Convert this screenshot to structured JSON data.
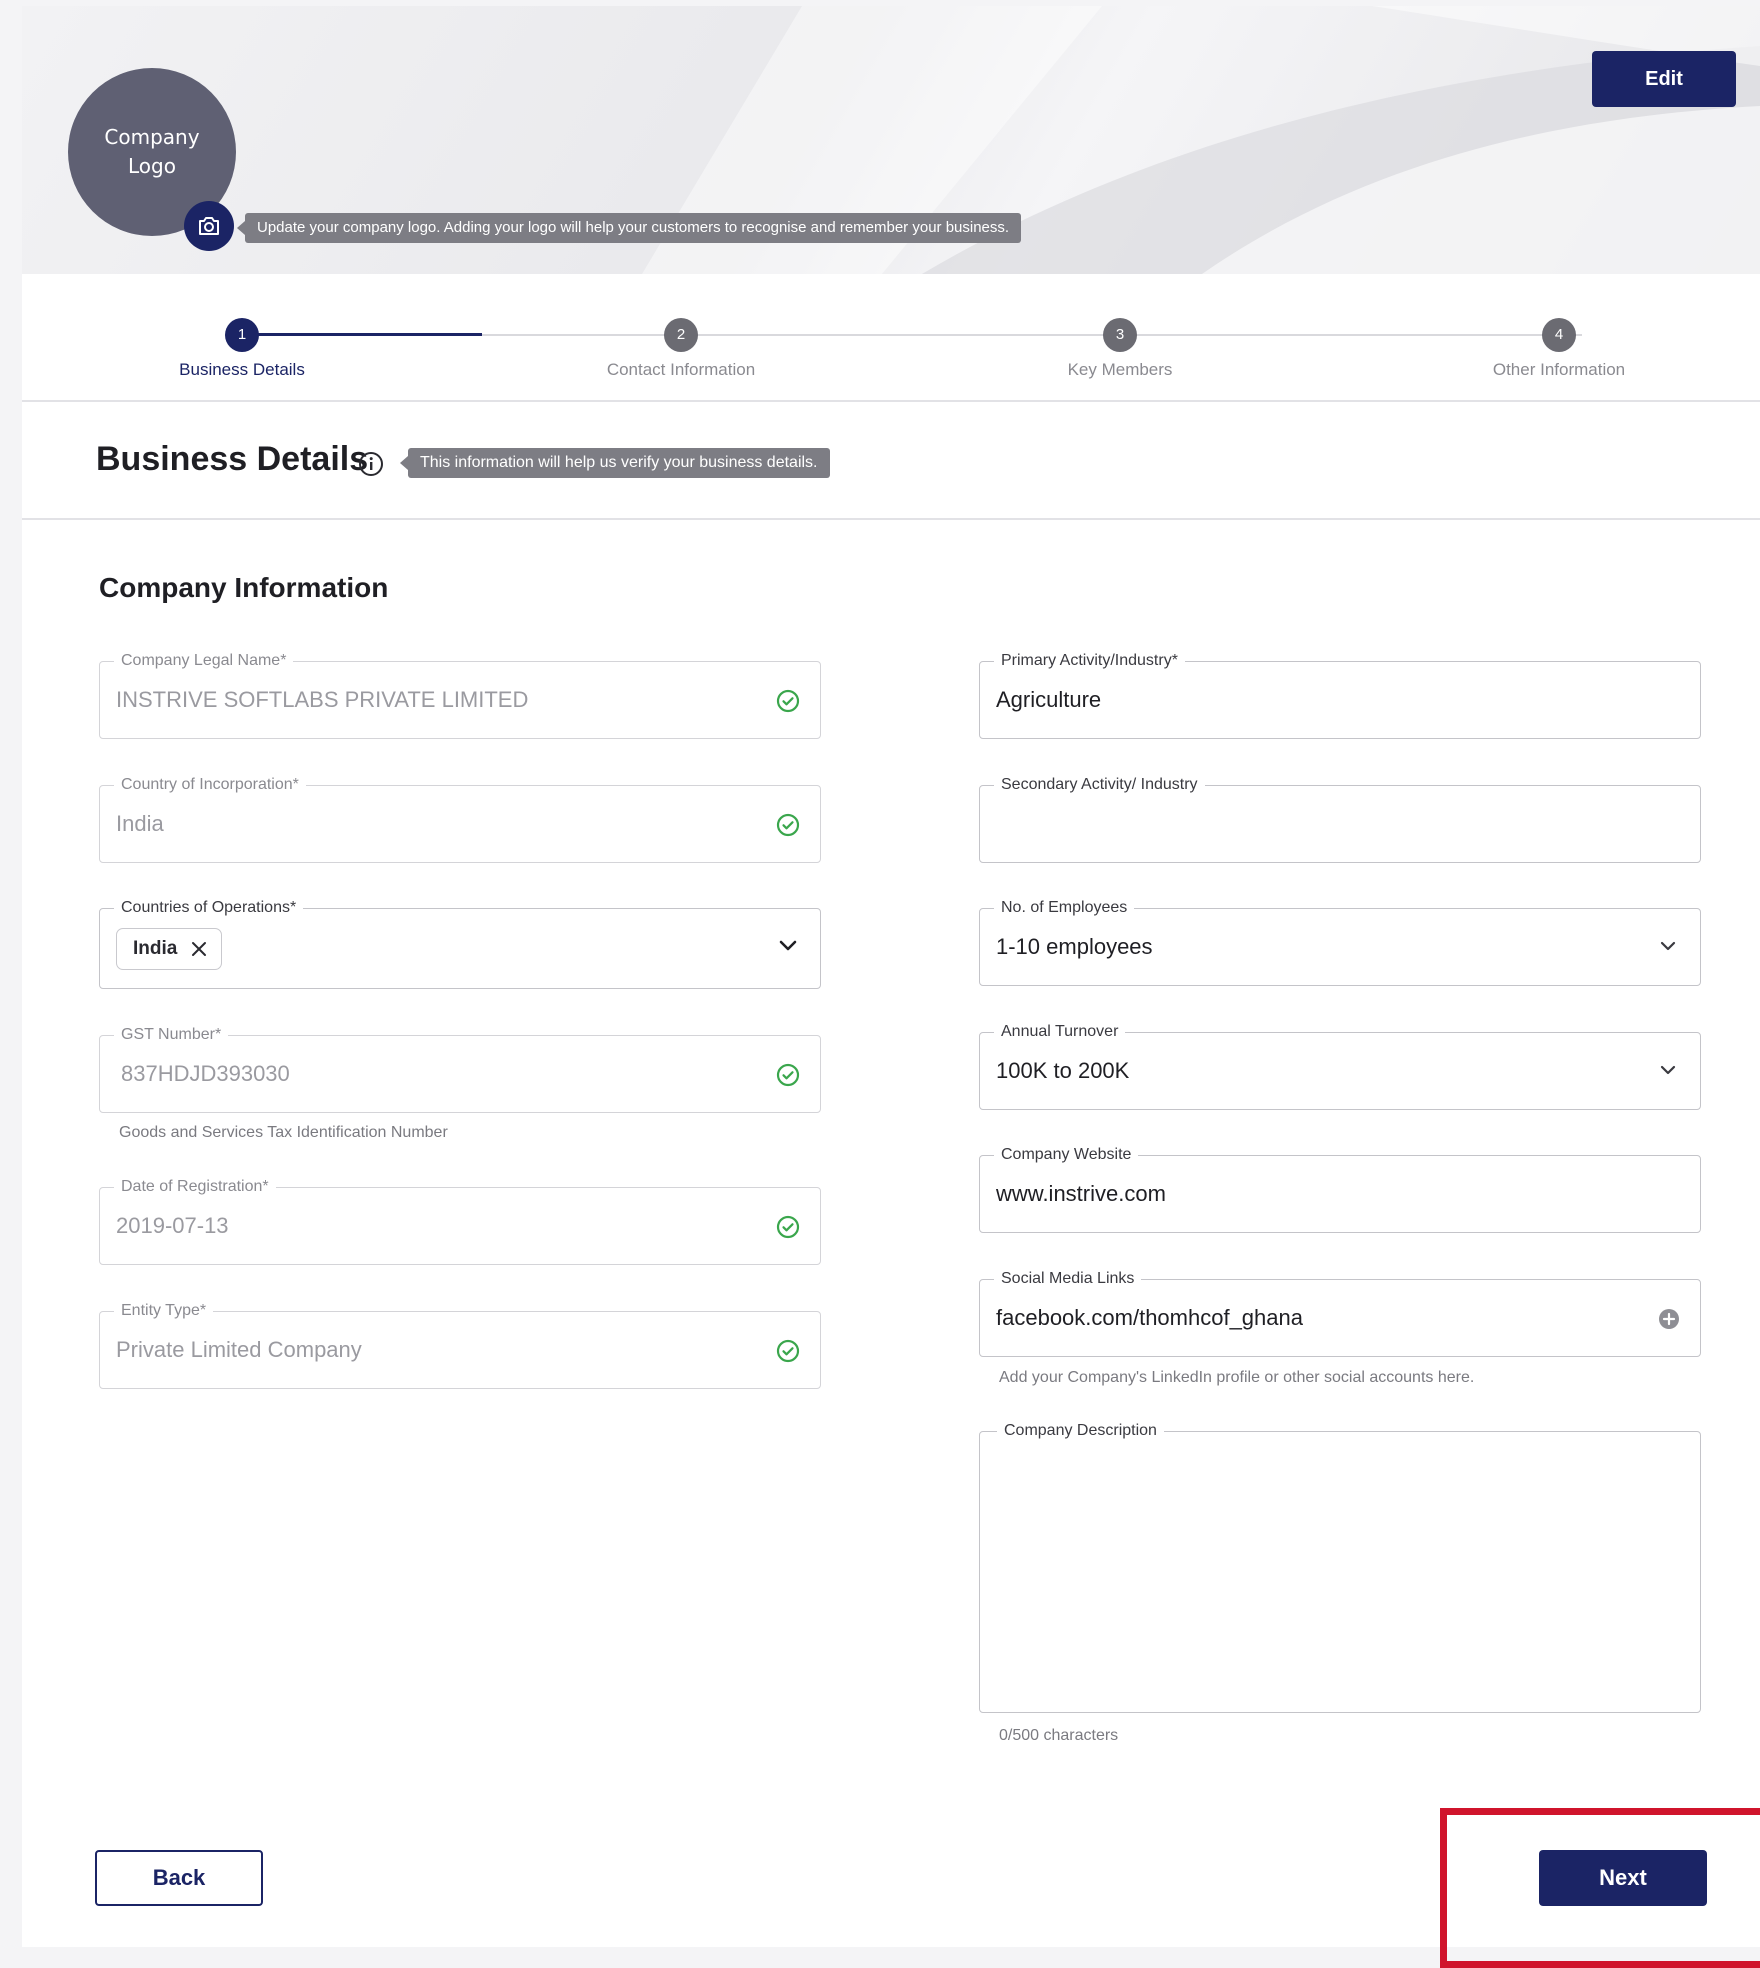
{
  "banner": {
    "logo_text": "Company Logo",
    "logo_tooltip": "Update your company logo. Adding your logo will help your customers to recognise and remember your business.",
    "edit_label": "Edit"
  },
  "stepper": {
    "steps": [
      {
        "number": "1",
        "label": "Business Details",
        "active": true
      },
      {
        "number": "2",
        "label": "Contact Information",
        "active": false
      },
      {
        "number": "3",
        "label": "Key Members",
        "active": false
      },
      {
        "number": "4",
        "label": "Other Information",
        "active": false
      }
    ]
  },
  "section": {
    "title": "Business Details",
    "tooltip": "This information will help us verify your business details.",
    "subtitle": "Company Information"
  },
  "left_fields": {
    "legal_name": {
      "label": "Company Legal Name*",
      "value": "INSTRIVE SOFTLABS PRIVATE LIMITED"
    },
    "country_incorporation": {
      "label": "Country of Incorporation*",
      "value": "India"
    },
    "countries_operations": {
      "label": "Countries of Operations*",
      "chip": "India"
    },
    "gst_number": {
      "label": "GST Number*",
      "value": "837HDJD393030",
      "helper": "Goods and Services Tax Identification Number"
    },
    "date_registration": {
      "label": "Date of Registration*",
      "value": "2019-07-13"
    },
    "entity_type": {
      "label": "Entity Type*",
      "value": "Private Limited Company"
    }
  },
  "right_fields": {
    "primary_activity": {
      "label": "Primary Activity/Industry*",
      "value": "Agriculture"
    },
    "secondary_activity": {
      "label": "Secondary Activity/ Industry",
      "value": ""
    },
    "employees": {
      "label": "No. of Employees",
      "value": "1-10 employees"
    },
    "turnover": {
      "label": "Annual Turnover",
      "value": "100K to 200K"
    },
    "website": {
      "label": "Company Website",
      "value": "www.instrive.com"
    },
    "social": {
      "label": "Social Media Links",
      "value": "facebook.com/thomhcof_ghana",
      "helper": "Add your Company's LinkedIn profile or other social accounts here."
    },
    "description": {
      "label": "Company Description",
      "value": "",
      "counter": "0/500 characters"
    }
  },
  "actions": {
    "back_label": "Back",
    "next_label": "Next"
  },
  "colors": {
    "primary": "#1b2465",
    "success": "#3aa64c",
    "highlight": "#d0142c"
  },
  "icons": {
    "camera": "camera-icon",
    "info": "info-icon",
    "check": "check-circle-icon",
    "chevron": "chevron-down-icon",
    "remove": "close-icon",
    "add": "plus-circle-icon"
  }
}
